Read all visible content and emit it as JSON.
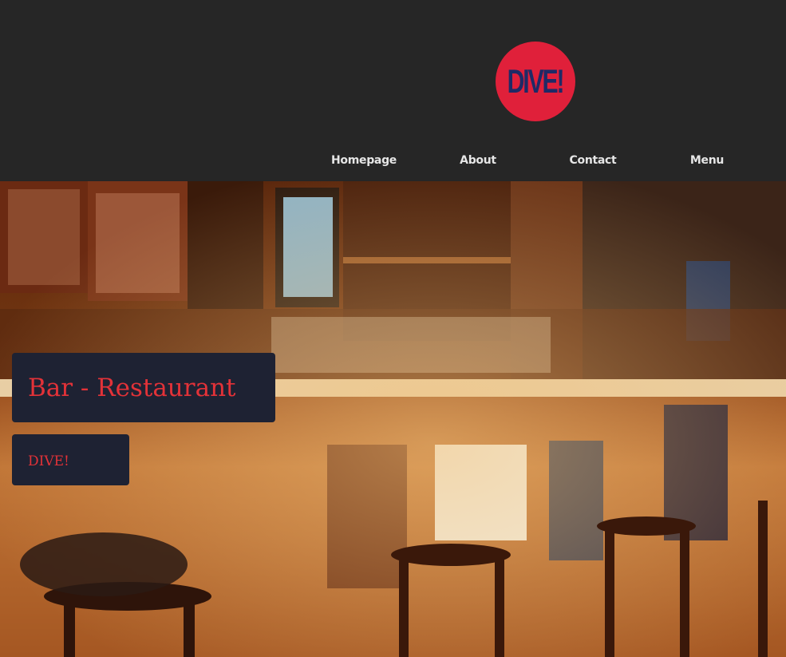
{
  "header": {
    "logo_text": "DIVE!",
    "logo_colors": {
      "circle": "#e0203a",
      "text": "#1f2a66"
    }
  },
  "nav": {
    "items": [
      {
        "label": "Homepage"
      },
      {
        "label": "About"
      },
      {
        "label": "Contact"
      },
      {
        "label": "Menu"
      }
    ]
  },
  "hero": {
    "image_icon": "bar-interior-photo",
    "title": "Bar - Restaurant",
    "tag": "DIVE!",
    "colors": {
      "box": "#1e2233",
      "text": "#e33238"
    }
  }
}
